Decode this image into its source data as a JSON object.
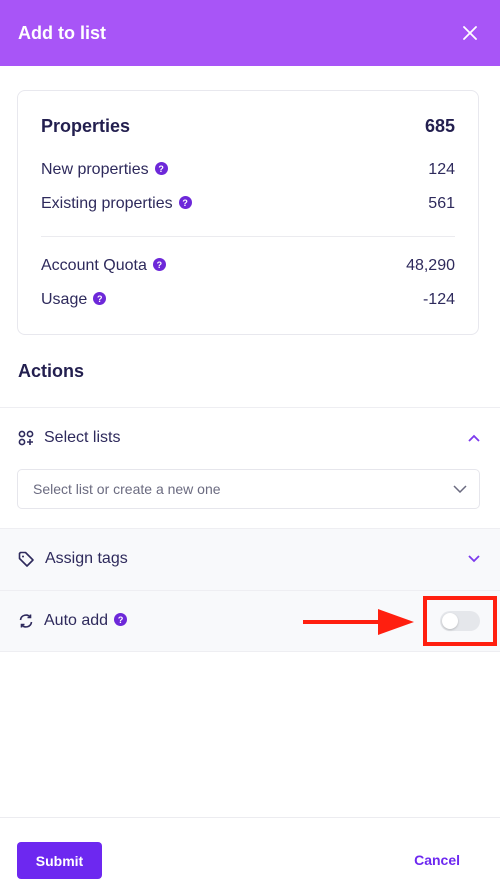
{
  "header": {
    "title": "Add to list",
    "close_icon": "close-icon"
  },
  "summary": {
    "title": "Properties",
    "total": "685",
    "rows": [
      {
        "label": "New properties",
        "value": "124",
        "help": true
      },
      {
        "label": "Existing properties",
        "value": "561",
        "help": true
      }
    ],
    "quota_rows": [
      {
        "label": "Account Quota",
        "value": "48,290",
        "help": true
      },
      {
        "label": "Usage",
        "value": "-124",
        "help": true
      }
    ]
  },
  "actions": {
    "title": "Actions",
    "select_lists": {
      "label": "Select lists",
      "icon": "grid-plus-icon",
      "expanded": true,
      "placeholder": "Select list or create a new one"
    },
    "assign_tags": {
      "label": "Assign tags",
      "icon": "tag-icon",
      "expanded": false
    },
    "auto_add": {
      "label": "Auto add",
      "icon": "refresh-icon",
      "enabled": false
    }
  },
  "help_glyph": "?",
  "footer": {
    "submit_label": "Submit",
    "cancel_label": "Cancel"
  },
  "colors": {
    "header_bg": "#a855f7",
    "primary": "#6d28f0",
    "highlight": "#ff1f0f"
  }
}
